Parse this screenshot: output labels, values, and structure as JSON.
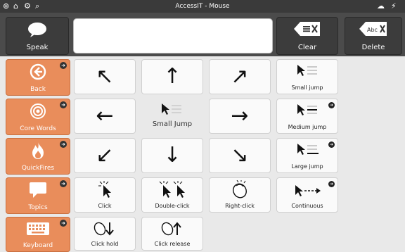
{
  "status_bar": {
    "title": "AccessIT - Mouse",
    "icons": [
      "back-circle-icon",
      "home-icon",
      "settings-icon",
      "search-icon",
      "cloud-icon",
      "bolt-off-icon"
    ]
  },
  "toolbar": {
    "speak_label": "Speak",
    "clear_label": "Clear",
    "delete_label": "Delete",
    "message_text": ""
  },
  "sidebar": {
    "items": [
      {
        "label": "Back",
        "icon": "back-arrow-icon"
      },
      {
        "label": "Core Words",
        "icon": "target-icon"
      },
      {
        "label": "QuickFires",
        "icon": "flame-icon"
      },
      {
        "label": "Topics",
        "icon": "speech-bubble-icon"
      },
      {
        "label": "Keyboard",
        "icon": "keyboard-icon"
      }
    ]
  },
  "grid": {
    "small_jump": "Small jump",
    "small_jump_center": "Small Jump",
    "medium_jump": "Medium jump",
    "large_jump": "Large jump",
    "click": "Click",
    "double_click": "Double-click",
    "right_click": "Right-click",
    "continuous": "Continuous",
    "click_hold": "Click hold",
    "click_release": "Click release"
  },
  "colors": {
    "sidebar_orange": "#e98d5b",
    "toolbar_dark": "#4b4b4b",
    "cell_bg": "#fafafa"
  }
}
